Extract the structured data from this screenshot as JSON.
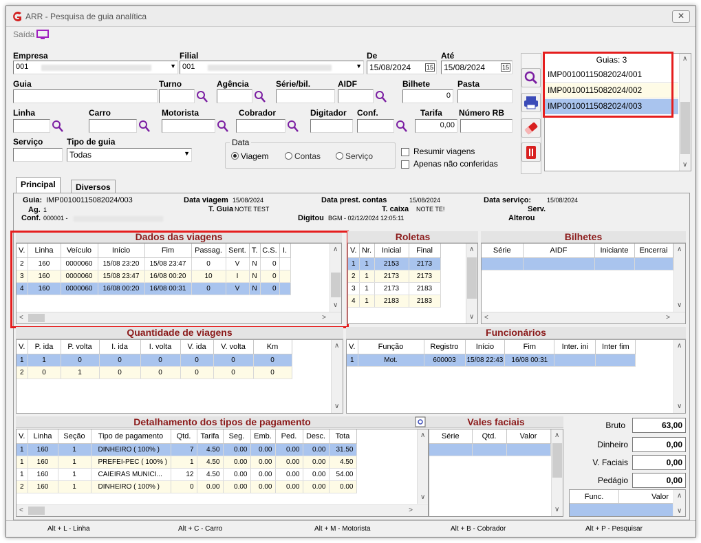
{
  "window": {
    "title": "ARR - Pesquisa de guia analítica"
  },
  "menu": {
    "exit": "Saída"
  },
  "filters": {
    "empresa_label": "Empresa",
    "empresa_value": "001",
    "filial_label": "Filial",
    "filial_value": "001",
    "de_label": "De",
    "de_value": "15/08/2024",
    "ate_label": "Até",
    "ate_value": "15/08/2024",
    "guia_label": "Guia",
    "turno_label": "Turno",
    "agencia_label": "Agência",
    "serie_label": "Série/bil.",
    "aidf_label": "AIDF",
    "bilhete_label": "Bilhete",
    "bilhete_value": "0",
    "pasta_label": "Pasta",
    "linha_label": "Linha",
    "carro_label": "Carro",
    "motorista_label": "Motorista",
    "cobrador_label": "Cobrador",
    "digitador_label": "Digitador",
    "conf_label": "Conf.",
    "tarifa_label": "Tarifa",
    "tarifa_value": "0,00",
    "numero_rb_label": "Número RB",
    "servico_label": "Serviço",
    "tipo_guia_label": "Tipo de guia",
    "tipo_guia_value": "Todas",
    "data_group": "Data",
    "data_opts": [
      "Viagem",
      "Contas",
      "Serviço"
    ],
    "resumir": "Resumir viagens",
    "apenas": "Apenas não conferidas"
  },
  "guias": {
    "header": "Guias: 3",
    "items": [
      "IMP00100115082024/001",
      "IMP00100115082024/002",
      "IMP00100115082024/003"
    ]
  },
  "tabs": [
    "Principal",
    "Diversos"
  ],
  "info": {
    "guia_label": "Guia:",
    "guia_value": "IMP00100115082024/003",
    "ag_label": "Ag.",
    "ag_value": "1",
    "conf_label": "Conf.",
    "conf_value": "000001 -",
    "data_viagem_label": "Data viagem",
    "data_viagem_value": "15/08/2024",
    "t_guia_label": "T. Guia",
    "t_guia_value": "NOTE TEST",
    "digitou_label": "Digitou",
    "digitou_value": "BGM - 02/12/2024 12:05:11",
    "data_prest_label": "Data prest. contas",
    "data_prest_value": "15/08/2024",
    "t_caixa_label": "T. caixa",
    "t_caixa_value": "NOTE TE!",
    "data_servico_label": "Data serviço:",
    "data_servico_value": "15/08/2024",
    "serv_label": "Serv.",
    "alterou_label": "Alterou"
  },
  "viagens": {
    "title": "Dados das viagens",
    "cols": [
      "V.",
      "Linha",
      "Veículo",
      "Início",
      "Fim",
      "Passag.",
      "Sent.",
      "T.",
      "C.S.",
      "I."
    ],
    "rows": [
      [
        "2",
        "160",
        "0000060",
        "15/08 23:20",
        "15/08 23:47",
        "0",
        "V",
        "N",
        "0",
        ""
      ],
      [
        "3",
        "160",
        "0000060",
        "15/08 23:47",
        "16/08 00:20",
        "10",
        "I",
        "N",
        "0",
        ""
      ],
      [
        "4",
        "160",
        "0000060",
        "16/08 00:20",
        "16/08 00:31",
        "0",
        "V",
        "N",
        "0",
        ""
      ]
    ]
  },
  "roletas": {
    "title": "Roletas",
    "cols": [
      "V.",
      "Nr.",
      "Inicial",
      "Final"
    ],
    "rows": [
      [
        "1",
        "1",
        "2153",
        "2173"
      ],
      [
        "2",
        "1",
        "2173",
        "2173"
      ],
      [
        "3",
        "1",
        "2173",
        "2183"
      ],
      [
        "4",
        "1",
        "2183",
        "2183"
      ]
    ]
  },
  "bilhetes": {
    "title": "Bilhetes",
    "cols": [
      "Série",
      "AIDF",
      "Iniciante",
      "Encerrai"
    ]
  },
  "quantidade": {
    "title": "Quantidade de viagens",
    "cols": [
      "V.",
      "P. ida",
      "P. volta",
      "I. ida",
      "I. volta",
      "V. ida",
      "V. volta",
      "Km"
    ],
    "rows": [
      [
        "1",
        "1",
        "0",
        "0",
        "0",
        "0",
        "0",
        "0"
      ],
      [
        "2",
        "0",
        "1",
        "0",
        "0",
        "0",
        "0",
        "0"
      ]
    ]
  },
  "funcionarios": {
    "title": "Funcionários",
    "cols": [
      "V.",
      "Função",
      "Registro",
      "Início",
      "Fim",
      "Inter. ini",
      "Inter fim"
    ],
    "rows": [
      [
        "1",
        "Mot.",
        "600003",
        "15/08 22:43",
        "16/08 00:31",
        "",
        ""
      ]
    ]
  },
  "pagamento": {
    "title": "Detalhamento dos tipos de pagamento",
    "cols": [
      "V.",
      "Linha",
      "Seção",
      "Tipo de pagamento",
      "Qtd.",
      "Tarifa",
      "Seg.",
      "Emb.",
      "Ped.",
      "Desc.",
      "Tota"
    ],
    "rows": [
      [
        "1",
        "160",
        "1",
        "DINHEIRO ( 100% )",
        "7",
        "4.50",
        "0.00",
        "0.00",
        "0.00",
        "0.00",
        "31.50"
      ],
      [
        "1",
        "160",
        "1",
        "PREFEI-PEC ( 100% )",
        "1",
        "4.50",
        "0.00",
        "0.00",
        "0.00",
        "0.00",
        "4.50"
      ],
      [
        "1",
        "160",
        "1",
        "CAIEIRAS MUNICI...",
        "12",
        "4.50",
        "0.00",
        "0.00",
        "0.00",
        "0.00",
        "54.00"
      ],
      [
        "2",
        "160",
        "1",
        "DINHEIRO ( 100% )",
        "0",
        "0.00",
        "0.00",
        "0.00",
        "0.00",
        "0.00",
        "0.00"
      ]
    ]
  },
  "vales": {
    "title": "Vales faciais",
    "cols": [
      "Série",
      "Qtd.",
      "Valor"
    ]
  },
  "totais": {
    "bruto_label": "Bruto",
    "bruto": "63,00",
    "dinheiro_label": "Dinheiro",
    "dinheiro": "0,00",
    "vfaciais_label": "V. Faciais",
    "vfaciais": "0,00",
    "pedagio_label": "Pedágio",
    "pedagio": "0,00",
    "func_col": "Func.",
    "valor_col": "Valor"
  },
  "statusbar": [
    "Alt + L - Linha",
    "Alt + C - Carro",
    "Alt + M - Motorista",
    "Alt + B - Cobrador",
    "Alt + P - Pesquisar"
  ],
  "colors": {
    "selected_row": "#a9c4ee",
    "section_title": "#8b1a1a",
    "highlight_box": "#e51d1d",
    "app_icon": "#d32020"
  }
}
